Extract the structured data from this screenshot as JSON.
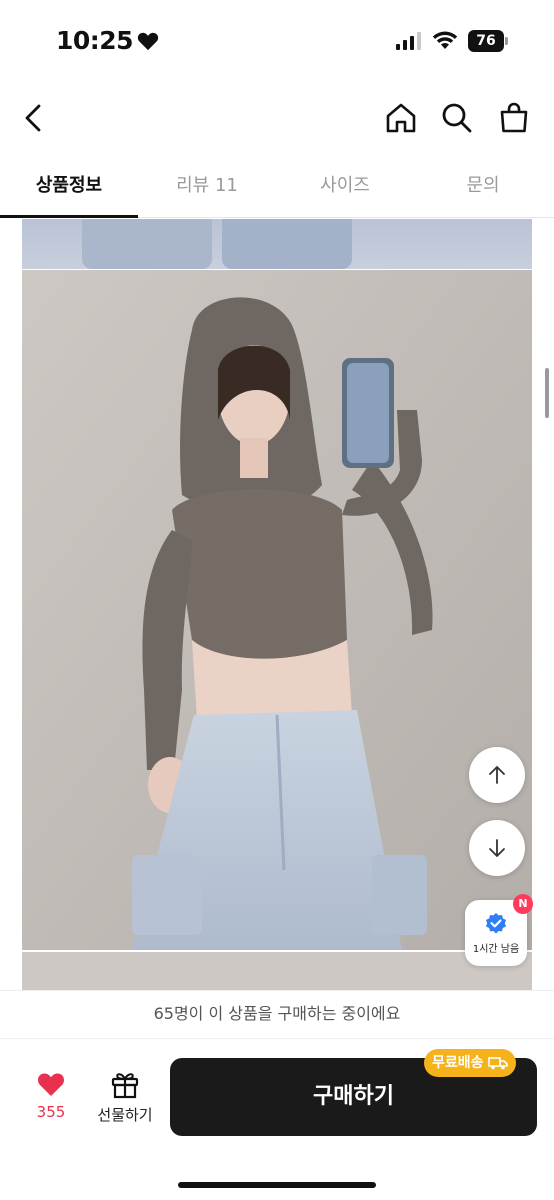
{
  "status_bar": {
    "time": "10:25",
    "battery": "76"
  },
  "header": {
    "back_icon": "chevron-left-icon",
    "home_icon": "home-icon",
    "search_icon": "search-icon",
    "bag_icon": "shopping-bag-icon"
  },
  "tabs": [
    {
      "label": "상품정보",
      "active": true
    },
    {
      "label": "리뷰 11",
      "active": false
    },
    {
      "label": "사이즈",
      "active": false
    },
    {
      "label": "문의",
      "active": false
    }
  ],
  "product_images": {
    "description": "product detail photos"
  },
  "floating": {
    "scroll_up_icon": "arrow-up-icon",
    "scroll_down_icon": "arrow-down-icon",
    "timer_badge_label": "1시간 남음",
    "timer_badge_new": "N"
  },
  "purchase_banner": {
    "text": "65명이 이 상품을 구매하는 중이에요"
  },
  "bottom_bar": {
    "like_count": "355",
    "gift_label": "선물하기",
    "buy_label": "구매하기",
    "free_shipping_label": "무료배송"
  },
  "colors": {
    "accent_red": "#e8304f",
    "buy_button": "#1a1a1a",
    "free_shipping": "#f6b21b",
    "verified_blue": "#2f7ef5"
  }
}
